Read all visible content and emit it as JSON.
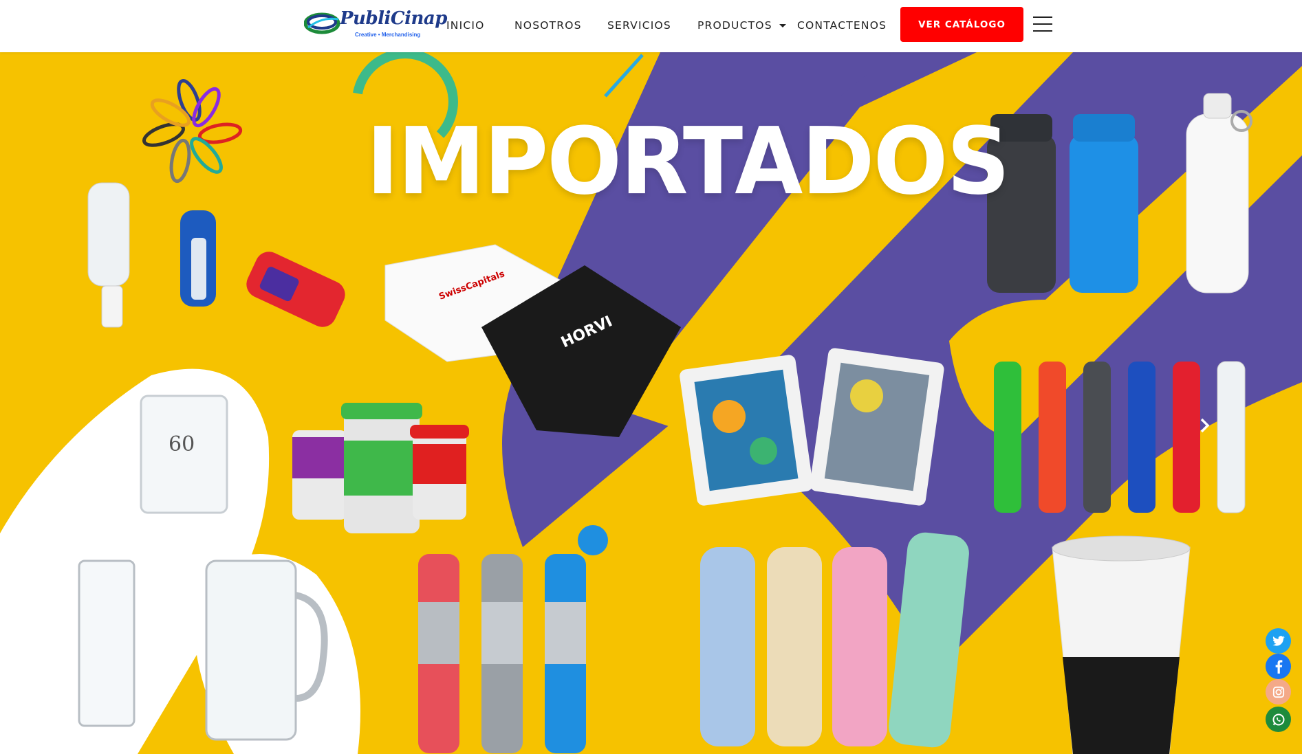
{
  "logo": {
    "name": "PubliCinap",
    "tagline": "Creative • Merchandising"
  },
  "nav": {
    "items": [
      {
        "label": "INICIO"
      },
      {
        "label": "NOSOTROS"
      },
      {
        "label": "SERVICIOS"
      },
      {
        "label": "PRODUCTOS",
        "has_dropdown": true
      },
      {
        "label": "CONTACTENOS"
      }
    ],
    "cta_label": "VER CATÁLOGO"
  },
  "hero": {
    "title": "IMPORTADOS",
    "prev_icon": "chevron-left-icon",
    "next_icon": "chevron-right-icon",
    "colors": {
      "yellow": "#f6c200",
      "purple": "#5a4ea2",
      "white": "#ffffff",
      "teal": "#3dba8a"
    }
  },
  "social": [
    {
      "name": "twitter-icon",
      "color": "#1da1f2",
      "glyph": "t"
    },
    {
      "name": "facebook-icon",
      "color": "#1877f2",
      "glyph": "f"
    },
    {
      "name": "instagram-icon",
      "color": "#f4a988",
      "glyph": "◎"
    },
    {
      "name": "whatsapp-icon",
      "color": "#1e8b3c",
      "glyph": "✆"
    }
  ],
  "colors": {
    "cta": "#ff0000",
    "nav_text": "#222222"
  }
}
